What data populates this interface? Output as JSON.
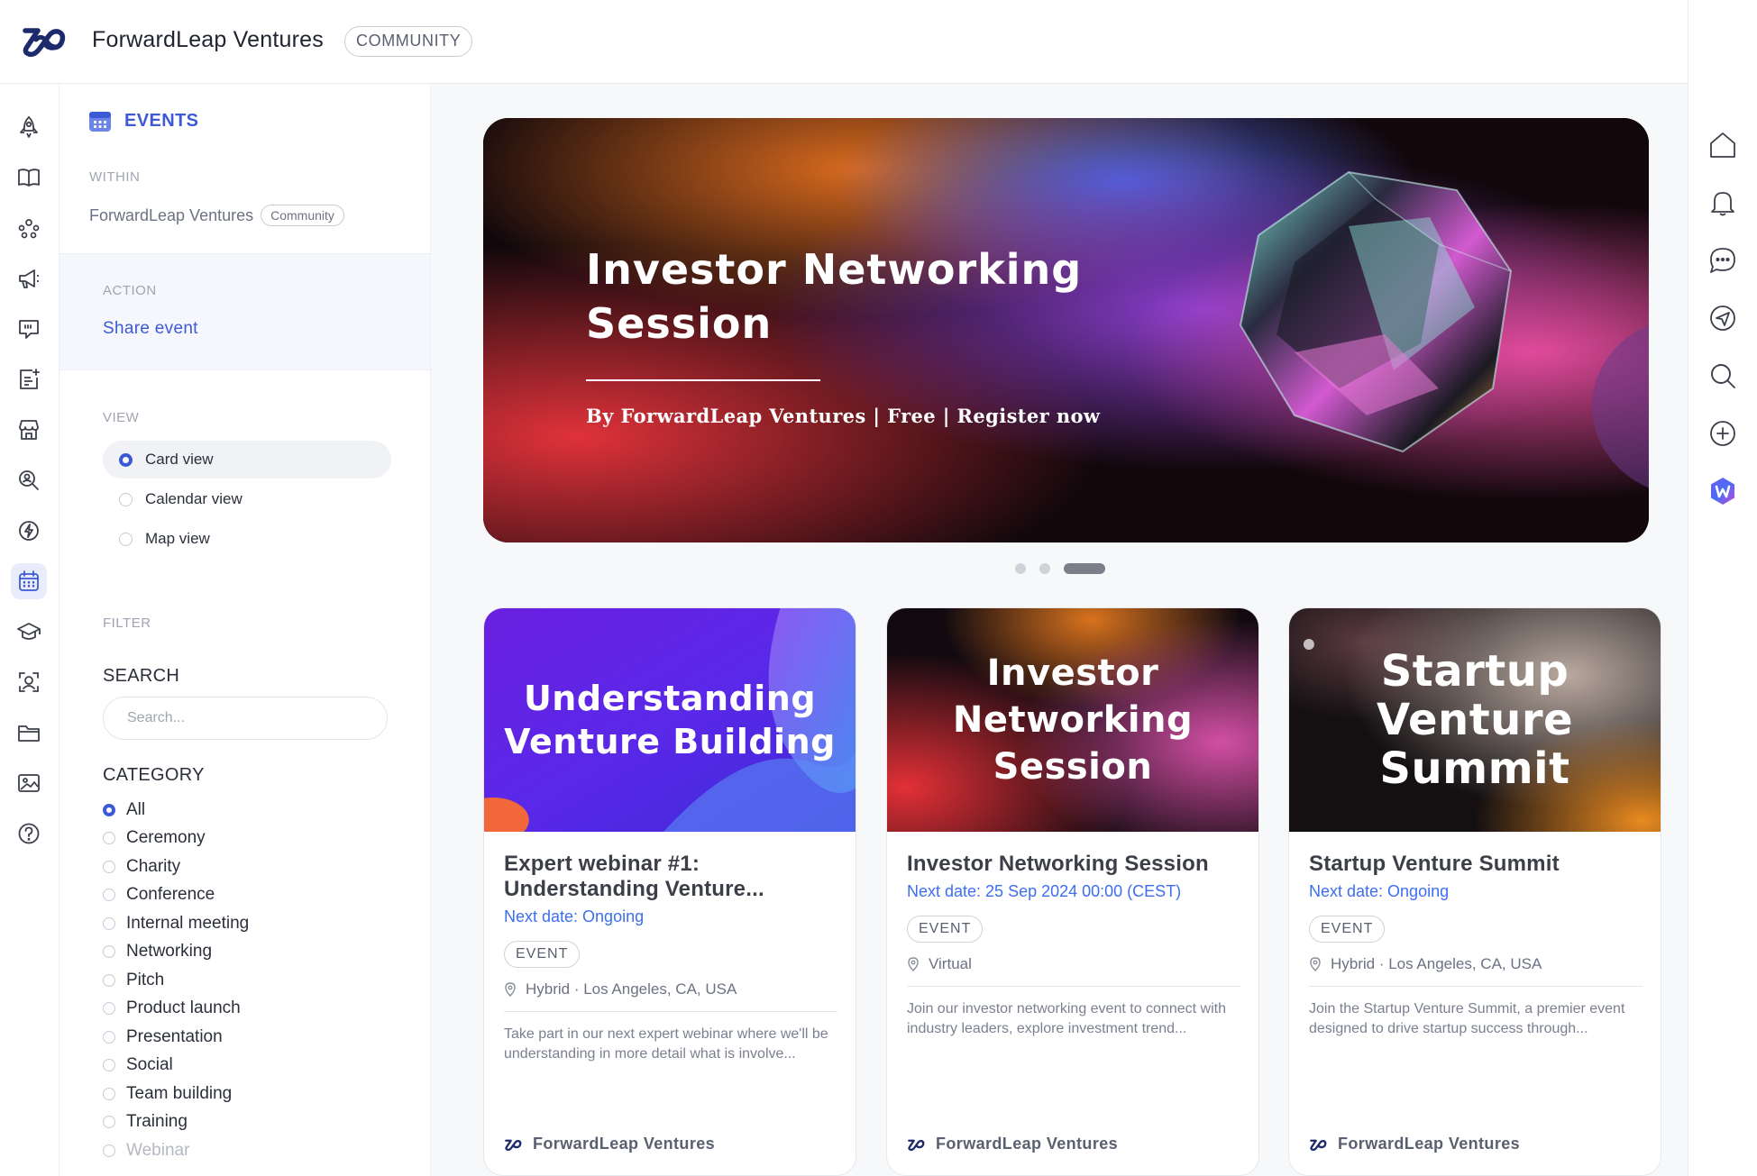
{
  "header": {
    "brand_name": "ForwardLeap Ventures",
    "brand_badge": "COMMUNITY"
  },
  "left_rail": {
    "icons": [
      "rocket-icon",
      "book-icon",
      "community-icon",
      "megaphone-icon",
      "chat-quote-icon",
      "new-post-icon",
      "store-icon",
      "search-people-icon",
      "lightning-icon",
      "calendar-icon",
      "graduation-cap-icon",
      "face-scan-icon",
      "folder-icon",
      "gallery-icon",
      "help-icon"
    ],
    "active": "calendar-icon"
  },
  "subnav": {
    "title": "EVENTS",
    "within_label": "WITHIN",
    "within_name": "ForwardLeap Ventures",
    "within_badge": "Community",
    "action_label": "ACTION",
    "share_event": "Share event",
    "view_label": "VIEW",
    "views": [
      {
        "label": "Card view",
        "selected": true
      },
      {
        "label": "Calendar view",
        "selected": false
      },
      {
        "label": "Map view",
        "selected": false
      }
    ],
    "filter_label": "FILTER",
    "search_label": "SEARCH",
    "search_placeholder": "Search...",
    "category_label": "CATEGORY",
    "categories": [
      {
        "label": "All",
        "selected": true
      },
      {
        "label": "Ceremony",
        "selected": false
      },
      {
        "label": "Charity",
        "selected": false
      },
      {
        "label": "Conference",
        "selected": false
      },
      {
        "label": "Internal meeting",
        "selected": false
      },
      {
        "label": "Networking",
        "selected": false
      },
      {
        "label": "Pitch",
        "selected": false
      },
      {
        "label": "Product launch",
        "selected": false
      },
      {
        "label": "Presentation",
        "selected": false
      },
      {
        "label": "Social",
        "selected": false
      },
      {
        "label": "Team building",
        "selected": false
      },
      {
        "label": "Training",
        "selected": false
      },
      {
        "label": "Webinar",
        "selected": false
      }
    ]
  },
  "hero": {
    "title": "Investor Networking Session",
    "subtitle": "By ForwardLeap Ventures | Free | Register now",
    "slide_count": 3,
    "active_slide": 3
  },
  "cards": [
    {
      "image_text": "Understanding Venture Building",
      "title": "Expert webinar #1: Understanding Venture...",
      "date": "Next date: Ongoing",
      "tag": "EVENT",
      "location": "Hybrid · Los Angeles, CA, USA",
      "description": "Take part in our next expert webinar where we'll be understanding in more detail what is involve...",
      "organizer": "ForwardLeap Ventures"
    },
    {
      "image_text": "Investor Networking Session",
      "title": "Investor Networking Session",
      "date": "Next date: 25 Sep 2024 00:00 (CEST)",
      "tag": "EVENT",
      "location": "Virtual",
      "description": "Join our investor networking event to connect with industry leaders, explore investment trend...",
      "organizer": "ForwardLeap Ventures"
    },
    {
      "image_text": "Startup Venture Summit",
      "title": "Startup Venture Summit",
      "date": "Next date: Ongoing",
      "tag": "EVENT",
      "location": "Hybrid · Los Angeles, CA, USA",
      "description": "Join the Startup Venture Summit, a premier event designed to drive startup success through...",
      "organizer": "ForwardLeap Ventures"
    }
  ],
  "right_rail": {
    "icons": [
      "home-icon",
      "bell-icon",
      "messages-icon",
      "send-icon",
      "search-icon",
      "add-icon",
      "app-w-icon"
    ]
  },
  "colors": {
    "accent": "#3d5ad6",
    "link": "#3d6ef0",
    "brand_navy": "#1d2a6b"
  }
}
